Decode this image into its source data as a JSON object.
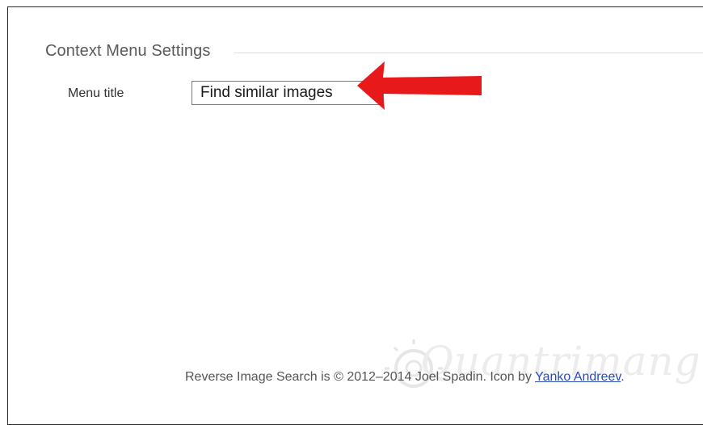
{
  "settings": {
    "section_title": "Context Menu Settings",
    "menu_title_label": "Menu title",
    "menu_title_value": "Find similar images"
  },
  "footer": {
    "text": "Reverse Image Search is © 2012–2014 Joel Spadin. Icon by ",
    "link_text": "Yanko Andreev",
    "suffix": "."
  },
  "annotation": {
    "arrow_color": "#e8191b",
    "arrow_icon": "arrow-left-icon"
  },
  "watermark": {
    "text": "Quantrimang"
  }
}
